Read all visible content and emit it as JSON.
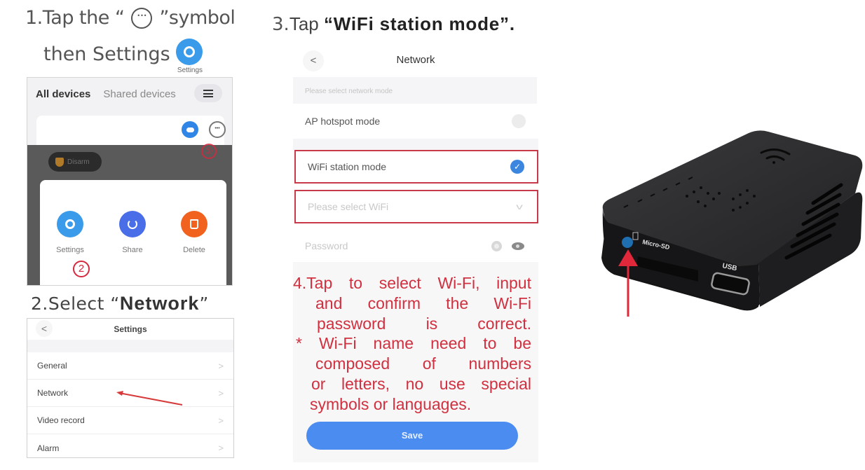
{
  "step1": {
    "line1_prefix": "1.Tap the  “",
    "line1_suffix": "”symbol",
    "more_symbol_icon": "more-horizontal-circle-icon",
    "line2": "then Settings",
    "settings_badge_label": "Settings",
    "screen": {
      "tabs": [
        {
          "label": "All devices",
          "active": true
        },
        {
          "label": "Shared devices",
          "active": false
        }
      ],
      "menu_icon": "hamburger-icon",
      "device_card_icons": [
        "cloud-icon",
        "more-icon"
      ],
      "marker_1": "①",
      "disarm_label": "Disarm",
      "actions": [
        {
          "label": "Settings",
          "icon": "gear-icon",
          "color": "#3a9bea"
        },
        {
          "label": "Share",
          "icon": "share-icon",
          "color": "#4a6ee8"
        },
        {
          "label": "Delete",
          "icon": "trash-icon",
          "color": "#f0621e"
        }
      ],
      "marker_2": "2"
    }
  },
  "step2": {
    "heading_prefix": "2.Select  “",
    "heading_bold": "Network",
    "heading_suffix": "”",
    "screen": {
      "title": "Settings",
      "back_label": "<",
      "rows": [
        {
          "label": "General"
        },
        {
          "label": "Network"
        },
        {
          "label": "Video record"
        },
        {
          "label": "Alarm"
        }
      ],
      "chevron": ">"
    }
  },
  "step3": {
    "heading_num": "3.",
    "heading_text": "Tap ",
    "heading_bold": "“WiFi station mode”.",
    "screen": {
      "title": "Network",
      "back_label": "<",
      "mode_hint": "Please select network mode",
      "ap_mode_label": "AP hotspot mode",
      "ap_mode_selected": false,
      "station_mode_label": "WiFi station mode",
      "station_mode_selected": true,
      "wifi_select_placeholder": "Please select WiFi",
      "password_placeholder": "Password",
      "save_label": "Save"
    }
  },
  "step4": {
    "lines": [
      "4.Tap to select Wi-Fi, input",
      "and confirm the Wi-Fi",
      "password is correct.",
      "* Wi-Fi name need to be",
      "composed of numbers",
      "or letters, no use special",
      "symbols or languages."
    ]
  },
  "device": {
    "sd_label": "Micro-SD",
    "usb_label": "USB",
    "indicator_color": "#1f6fb0"
  },
  "colors": {
    "accent_blue": "#4a8cf0",
    "highlight_red": "#c83a4a",
    "note_red": "#d0303f"
  }
}
